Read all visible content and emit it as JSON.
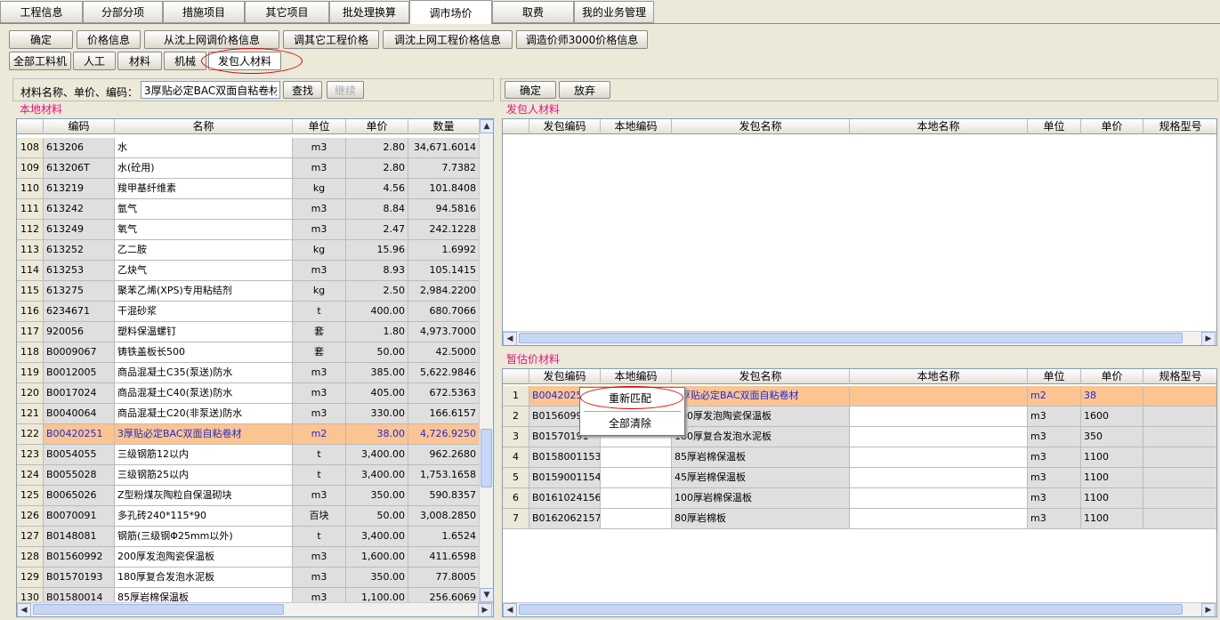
{
  "top_tabs": [
    "工程信息",
    "分部分项",
    "措施项目",
    "其它项目",
    "批处理换算",
    "调市场价",
    "取费",
    "我的业务管理"
  ],
  "toolbar": [
    "确定",
    "价格信息",
    "从沈上网调价格信息",
    "调其它工程价格",
    "调沈上网工程价格信息",
    "调造价师3000价格信息"
  ],
  "sub_tabs": [
    "全部工料机",
    "人工",
    "材料",
    "机械",
    "发包人材料"
  ],
  "search": {
    "label": "材料名称、单价、编码：",
    "value": "3厚贴必定BAC双面自粘卷材",
    "find": "查找",
    "continue": "继续"
  },
  "local_title": "本地材料",
  "local_headers": [
    "编码",
    "名称",
    "单位",
    "单价",
    "数量"
  ],
  "local_rows": [
    {
      "n": "108",
      "code": "613206",
      "name": "水",
      "unit": "m3",
      "price": "2.80",
      "qty": "34,671.6014"
    },
    {
      "n": "109",
      "code": "613206T",
      "name": "水(砼用)",
      "unit": "m3",
      "price": "2.80",
      "qty": "7.7382"
    },
    {
      "n": "110",
      "code": "613219",
      "name": "羧甲基纤维素",
      "unit": "kg",
      "price": "4.56",
      "qty": "101.8408"
    },
    {
      "n": "111",
      "code": "613242",
      "name": "氩气",
      "unit": "m3",
      "price": "8.84",
      "qty": "94.5816"
    },
    {
      "n": "112",
      "code": "613249",
      "name": "氧气",
      "unit": "m3",
      "price": "2.47",
      "qty": "242.1228"
    },
    {
      "n": "113",
      "code": "613252",
      "name": "乙二胺",
      "unit": "kg",
      "price": "15.96",
      "qty": "1.6992"
    },
    {
      "n": "114",
      "code": "613253",
      "name": "乙炔气",
      "unit": "m3",
      "price": "8.93",
      "qty": "105.1415"
    },
    {
      "n": "115",
      "code": "613275",
      "name": "聚苯乙烯(XPS)专用粘结剂",
      "unit": "kg",
      "price": "2.50",
      "qty": "2,984.2200"
    },
    {
      "n": "116",
      "code": "6234671",
      "name": "干混砂浆",
      "unit": "t",
      "price": "400.00",
      "qty": "680.7066"
    },
    {
      "n": "117",
      "code": "920056",
      "name": "塑料保温螺钉",
      "unit": "套",
      "price": "1.80",
      "qty": "4,973.7000"
    },
    {
      "n": "118",
      "code": "B0009067",
      "name": "铸铁盖板长500",
      "unit": "套",
      "price": "50.00",
      "qty": "42.5000"
    },
    {
      "n": "119",
      "code": "B0012005",
      "name": "商品混凝土C35(泵送)防水",
      "unit": "m3",
      "price": "385.00",
      "qty": "5,622.9846"
    },
    {
      "n": "120",
      "code": "B0017024",
      "name": "商品混凝土C40(泵送)防水",
      "unit": "m3",
      "price": "405.00",
      "qty": "672.5363"
    },
    {
      "n": "121",
      "code": "B0040064",
      "name": "商品混凝土C20(非泵送)防水",
      "unit": "m3",
      "price": "330.00",
      "qty": "166.6157"
    },
    {
      "n": "122",
      "code": "B00420251",
      "name": "3厚贴必定BAC双面自粘卷材",
      "unit": "m2",
      "price": "38.00",
      "qty": "4,726.9250",
      "selected": true
    },
    {
      "n": "123",
      "code": "B0054055",
      "name": "三级钢筋12以内",
      "unit": "t",
      "price": "3,400.00",
      "qty": "962.2680"
    },
    {
      "n": "124",
      "code": "B0055028",
      "name": "三级钢筋25以内",
      "unit": "t",
      "price": "3,400.00",
      "qty": "1,753.1658"
    },
    {
      "n": "125",
      "code": "B0065026",
      "name": "Z型粉煤灰陶粒自保温砌块",
      "unit": "m3",
      "price": "350.00",
      "qty": "590.8357"
    },
    {
      "n": "126",
      "code": "B0070091",
      "name": "多孔砖240*115*90",
      "unit": "百块",
      "price": "50.00",
      "qty": "3,008.2850"
    },
    {
      "n": "127",
      "code": "B0148081",
      "name": "钢筋(三级钢Φ25mm以外)",
      "unit": "t",
      "price": "3,400.00",
      "qty": "1.6524"
    },
    {
      "n": "128",
      "code": "B01560992",
      "name": "200厚发泡陶瓷保温板",
      "unit": "m3",
      "price": "1,600.00",
      "qty": "411.6598"
    },
    {
      "n": "129",
      "code": "B01570193",
      "name": "180厚复合发泡水泥板",
      "unit": "m3",
      "price": "350.00",
      "qty": "77.8005"
    },
    {
      "n": "130",
      "code": "B01580014",
      "name": "85厚岩棉保温板",
      "unit": "m3",
      "price": "1,100.00",
      "qty": "256.6069"
    }
  ],
  "right_buttons": [
    "确定",
    "放弃"
  ],
  "owner_title": "发包人材料",
  "right_headers": [
    "发包编码",
    "本地编码",
    "发包名称",
    "本地名称",
    "单位",
    "单价",
    "规格型号"
  ],
  "temp_title": "暂估价材料",
  "temp_rows": [
    {
      "n": "1",
      "code": "B00420251",
      "local": "",
      "name": "3厚贴必定BAC双面自粘卷材",
      "lname": "",
      "unit": "m2",
      "price": "38",
      "selected": true
    },
    {
      "n": "2",
      "code": "B01560991",
      "local": "",
      "name": "200厚发泡陶瓷保温板",
      "lname": "",
      "unit": "m3",
      "price": "1600"
    },
    {
      "n": "3",
      "code": "B01570191",
      "local": "",
      "name": "180厚复合发泡水泥板",
      "lname": "",
      "unit": "m3",
      "price": "350"
    },
    {
      "n": "4",
      "code": "B0158001153",
      "local": "",
      "name": "85厚岩棉保温板",
      "lname": "",
      "unit": "m3",
      "price": "1100"
    },
    {
      "n": "5",
      "code": "B0159001154",
      "local": "",
      "name": "45厚岩棉保温板",
      "lname": "",
      "unit": "m3",
      "price": "1100"
    },
    {
      "n": "6",
      "code": "B0161024156",
      "local": "",
      "name": "100厚岩棉保温板",
      "lname": "",
      "unit": "m3",
      "price": "1100"
    },
    {
      "n": "7",
      "code": "B0162062157",
      "local": "",
      "name": "80厚岩棉板",
      "lname": "",
      "unit": "m3",
      "price": "1100"
    }
  ],
  "context_menu": [
    "重新匹配",
    "全部清除"
  ]
}
